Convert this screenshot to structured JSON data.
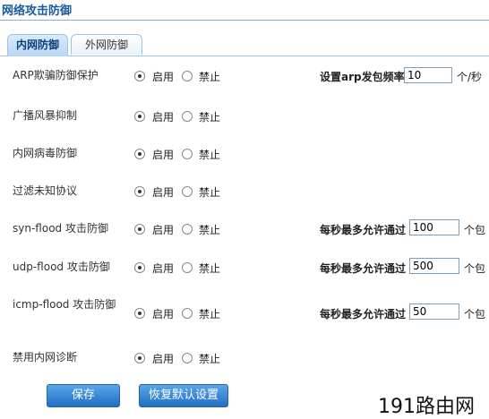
{
  "page": {
    "title": "网络攻击防御"
  },
  "tabs": [
    {
      "label": "内网防御",
      "active": true
    },
    {
      "label": "外网防御",
      "active": false
    }
  ],
  "options": {
    "enable": "启用",
    "disable": "禁止"
  },
  "rows": [
    {
      "label": "ARP欺骗防御保护",
      "state": "enable",
      "rate_label": "设置arp发包频率",
      "value": "10",
      "unit": "个/秒"
    },
    {
      "label": "广播风暴抑制",
      "state": "enable"
    },
    {
      "label": "内网病毒防御",
      "state": "enable"
    },
    {
      "label": "过滤未知协议",
      "state": "enable"
    },
    {
      "label": "syn-flood 攻击防御",
      "state": "enable",
      "rate_label": "每秒最多允许通过",
      "value": "100",
      "unit": "个包"
    },
    {
      "label": "udp-flood 攻击防御",
      "state": "enable",
      "rate_label": "每秒最多允许通过",
      "value": "500",
      "unit": "个包"
    },
    {
      "label": "icmp-flood 攻击防御",
      "state": "enable",
      "rate_label": "每秒最多允许通过",
      "value": "50",
      "unit": "个包"
    },
    {
      "label": "禁用内网诊断",
      "state": "enable"
    }
  ],
  "buttons": {
    "save": "保存",
    "reset": "恢复默认设置"
  },
  "watermark": {
    "text": "191路由网"
  },
  "colors": {
    "accent": "#1f6ec4",
    "title": "#1a5a99",
    "border": "#9cc3e8"
  }
}
